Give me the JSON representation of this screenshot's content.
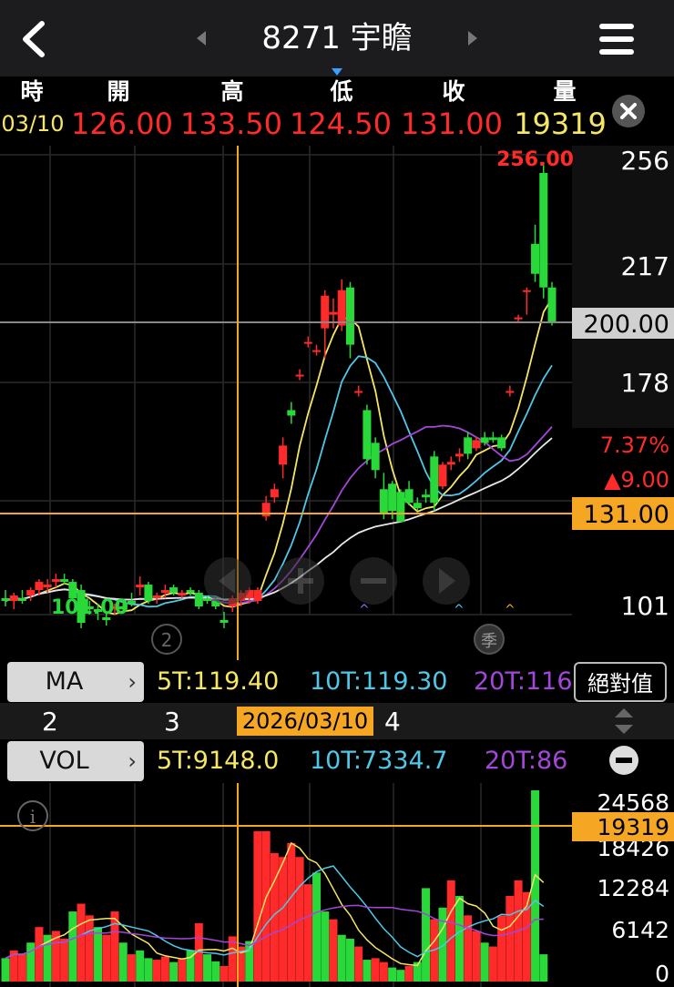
{
  "header": {
    "title": "8271 宇瞻"
  },
  "ohlc": {
    "labels": [
      "時",
      "開",
      "高",
      "低",
      "收",
      "量"
    ],
    "date": "03/10",
    "open": "126.00",
    "high": "133.50",
    "low": "124.50",
    "close": "131.00",
    "volume": "19319"
  },
  "price_axis": {
    "ticks": [
      "256",
      "217",
      "178",
      "101"
    ],
    "crosshair_price": "200.00",
    "change_pct": "7.37%",
    "change_abs": "▲9.00",
    "close_tag": "131.00",
    "high_label": "256.00",
    "low_label": "101.00"
  },
  "chart_controls": {
    "period_badge_left": "2",
    "period_badge_right": "季"
  },
  "ma_row": {
    "label": "MA",
    "ma5": "5T:119.40",
    "ma10": "10T:119.30",
    "ma20": "20T:116",
    "abs_button": "絕對值"
  },
  "date_row": {
    "p2": "2",
    "p3": "3",
    "date": "2026/03/10",
    "p4": "4"
  },
  "vol_row": {
    "label": "VOL",
    "ma5": "5T:9148.0",
    "ma10": "10T:7334.7",
    "ma20": "20T:86"
  },
  "vol_axis": {
    "ticks": [
      "24568",
      "18426",
      "12284",
      "6142",
      "0"
    ],
    "crosshair_tag": "19319"
  },
  "colors": {
    "up": "#ff2a2a",
    "down": "#29d939",
    "ma5": "#f5e663",
    "ma10": "#4fc8e8",
    "ma20": "#a347d9",
    "ma60": "#e8e8e8",
    "crosshair": "#f5a623"
  },
  "chart_data": {
    "type": "candlestick",
    "ylim": [
      90,
      262
    ],
    "candles": [
      {
        "o": 96,
        "h": 99,
        "l": 93,
        "c": 95
      },
      {
        "o": 95,
        "h": 98,
        "l": 92,
        "c": 97
      },
      {
        "o": 96,
        "h": 99,
        "l": 94,
        "c": 95
      },
      {
        "o": 97,
        "h": 100,
        "l": 95,
        "c": 99
      },
      {
        "o": 99,
        "h": 103,
        "l": 97,
        "c": 102
      },
      {
        "o": 100,
        "h": 103,
        "l": 98,
        "c": 101
      },
      {
        "o": 102,
        "h": 105,
        "l": 100,
        "c": 103
      },
      {
        "o": 103,
        "h": 105,
        "l": 101,
        "c": 102
      },
      {
        "o": 102,
        "h": 103,
        "l": 95,
        "c": 96
      },
      {
        "o": 99,
        "h": 101,
        "l": 85,
        "c": 87
      },
      {
        "o": 93,
        "h": 95,
        "l": 90,
        "c": 92
      },
      {
        "o": 92,
        "h": 94,
        "l": 88,
        "c": 91
      },
      {
        "o": 89,
        "h": 91,
        "l": 86,
        "c": 88
      },
      {
        "o": 92,
        "h": 94,
        "l": 90,
        "c": 93
      },
      {
        "o": 93,
        "h": 95,
        "l": 91,
        "c": 92
      },
      {
        "o": 95,
        "h": 98,
        "l": 93,
        "c": 94
      },
      {
        "o": 100,
        "h": 104,
        "l": 97,
        "c": 101
      },
      {
        "o": 101,
        "h": 102,
        "l": 94,
        "c": 95
      },
      {
        "o": 96,
        "h": 98,
        "l": 94,
        "c": 97
      },
      {
        "o": 98,
        "h": 101,
        "l": 96,
        "c": 99
      },
      {
        "o": 100,
        "h": 101,
        "l": 97,
        "c": 98
      },
      {
        "o": 97,
        "h": 99,
        "l": 96,
        "c": 98
      },
      {
        "o": 99,
        "h": 100,
        "l": 97,
        "c": 98
      },
      {
        "o": 98,
        "h": 99,
        "l": 92,
        "c": 93
      },
      {
        "o": 96,
        "h": 97,
        "l": 94,
        "c": 95
      },
      {
        "o": 95,
        "h": 96,
        "l": 92,
        "c": 93
      },
      {
        "o": 88,
        "h": 91,
        "l": 85,
        "c": 87
      },
      {
        "o": 93,
        "h": 97,
        "l": 91,
        "c": 96
      },
      {
        "o": 95,
        "h": 99,
        "l": 93,
        "c": 98
      },
      {
        "o": 96,
        "h": 100,
        "l": 94,
        "c": 99
      },
      {
        "o": 95,
        "h": 100,
        "l": 94,
        "c": 99
      },
      {
        "o": 126,
        "h": 133.5,
        "l": 124.5,
        "c": 131
      },
      {
        "o": 133,
        "h": 138,
        "l": 131,
        "c": 136
      },
      {
        "o": 145,
        "h": 155,
        "l": 140,
        "c": 152
      },
      {
        "o": 165,
        "h": 168,
        "l": 160,
        "c": 163
      },
      {
        "o": 178,
        "h": 180,
        "l": 176,
        "c": 178
      },
      {
        "o": 190,
        "h": 192,
        "l": 188,
        "c": 190
      },
      {
        "o": 187,
        "h": 189,
        "l": 185,
        "c": 187
      },
      {
        "o": 195,
        "h": 209,
        "l": 184,
        "c": 207
      },
      {
        "o": 200,
        "h": 206,
        "l": 195,
        "c": 201
      },
      {
        "o": 196,
        "h": 213,
        "l": 194,
        "c": 209
      },
      {
        "o": 210,
        "h": 212,
        "l": 184,
        "c": 189
      },
      {
        "o": 172,
        "h": 174,
        "l": 170,
        "c": 172
      },
      {
        "o": 165,
        "h": 167,
        "l": 145,
        "c": 147
      },
      {
        "o": 153,
        "h": 155,
        "l": 140,
        "c": 143
      },
      {
        "o": 136,
        "h": 142,
        "l": 125,
        "c": 127
      },
      {
        "o": 138,
        "h": 139,
        "l": 125,
        "c": 128
      },
      {
        "o": 135,
        "h": 136,
        "l": 124,
        "c": 124
      },
      {
        "o": 136,
        "h": 139,
        "l": 130,
        "c": 131
      },
      {
        "o": 131,
        "h": 133,
        "l": 128,
        "c": 129
      },
      {
        "o": 134,
        "h": 136,
        "l": 131,
        "c": 133
      },
      {
        "o": 148,
        "h": 150,
        "l": 128,
        "c": 131
      },
      {
        "o": 137,
        "h": 146,
        "l": 136,
        "c": 145
      },
      {
        "o": 145,
        "h": 148,
        "l": 143,
        "c": 146
      },
      {
        "o": 148,
        "h": 151,
        "l": 146,
        "c": 149
      },
      {
        "o": 155,
        "h": 157,
        "l": 147,
        "c": 149
      },
      {
        "o": 151,
        "h": 155,
        "l": 150,
        "c": 154
      },
      {
        "o": 155,
        "h": 157,
        "l": 152,
        "c": 153
      },
      {
        "o": 155,
        "h": 157,
        "l": 153,
        "c": 154
      },
      {
        "o": 155,
        "h": 156,
        "l": 150,
        "c": 151
      },
      {
        "o": 172,
        "h": 174,
        "l": 170,
        "c": 172
      },
      {
        "o": 199,
        "h": 200,
        "l": 197,
        "c": 199
      },
      {
        "o": 209,
        "h": 210,
        "l": 200,
        "c": 209
      },
      {
        "o": 226,
        "h": 233,
        "l": 212,
        "c": 215
      },
      {
        "o": 252,
        "h": 256,
        "l": 206,
        "c": 210
      },
      {
        "o": 210,
        "h": 212,
        "l": 196,
        "c": 197
      }
    ],
    "volumes": [
      3000,
      4000,
      3500,
      5000,
      7000,
      6000,
      6500,
      5500,
      9000,
      10000,
      8500,
      7000,
      6000,
      9000,
      5000,
      3500,
      4000,
      3000,
      2800,
      3200,
      2500,
      3000,
      4000,
      7500,
      3500,
      2600,
      2000,
      5800,
      4500,
      5200,
      19319,
      19319,
      16500,
      16000,
      17800,
      16000,
      12500,
      14000,
      9000,
      8000,
      6000,
      5500,
      4500,
      2800,
      3000,
      2500,
      1800,
      1500,
      2000,
      2500,
      12000,
      8000,
      9500,
      13000,
      11000,
      8500,
      6500,
      5000,
      4500,
      8500,
      11000,
      13000,
      11500,
      24568,
      3500
    ],
    "vol_up": [
      false,
      true,
      true,
      false,
      true,
      false,
      true,
      true,
      false,
      true,
      true,
      false,
      true,
      true,
      false,
      true,
      false,
      false,
      true,
      true,
      false,
      true,
      false,
      true,
      false,
      false,
      true,
      true,
      true,
      false,
      true,
      true,
      true,
      true,
      true,
      true,
      true,
      false,
      false,
      true,
      false,
      false,
      true,
      false,
      true,
      true,
      false,
      false,
      true,
      false,
      false,
      true,
      false,
      true,
      false,
      true,
      true,
      false,
      true,
      true,
      true,
      true,
      true,
      false,
      false
    ]
  }
}
